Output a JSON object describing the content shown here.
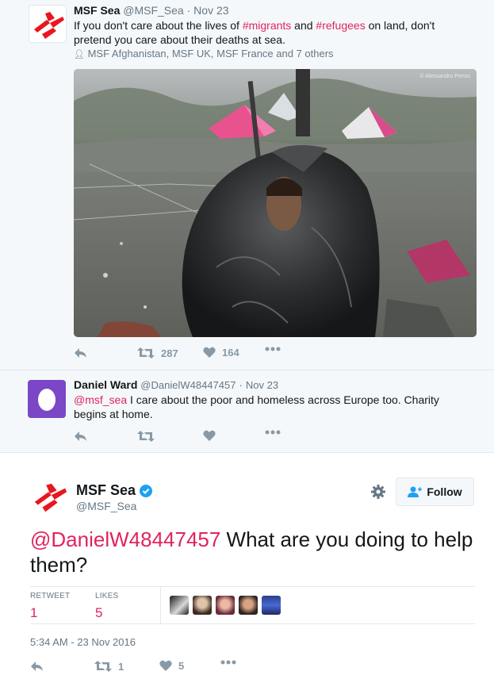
{
  "tweet1": {
    "name": "MSF Sea",
    "handle": "@MSF_Sea",
    "dot": "·",
    "date": "Nov 23",
    "text_before": "If you don't care about the lives of ",
    "hashtag1": "#migrants",
    "text_mid": " and ",
    "hashtag2": "#refugees",
    "text_after": " on land, don't pretend you care about their deaths at sea.",
    "context": "MSF Afghanistan, MSF UK, MSF France and 7 others",
    "photo_credit": "© Alessandro Penso",
    "retweets": "287",
    "likes": "164"
  },
  "tweet2": {
    "name": "Daniel Ward",
    "handle": "@DanielW48447457",
    "dot": "·",
    "date": "Nov 23",
    "mention": "@msf_sea",
    "text": " I care about the poor and homeless across Europe too. Charity begins at home."
  },
  "main": {
    "name": "MSF Sea",
    "handle": "@MSF_Sea",
    "follow_label": "Follow",
    "mention": "@DanielW48447457",
    "text": " What are you doing to help them?",
    "retweet_label": "RETWEET",
    "retweet_count": "1",
    "likes_label": "LIKES",
    "likes_count": "5",
    "timestamp": "5:34 AM - 23 Nov 2016",
    "action_retweets": "1",
    "action_likes": "5"
  },
  "icons": {
    "reply": "reply-icon",
    "retweet": "retweet-icon",
    "like": "heart-icon",
    "more": "more-icon",
    "verified": "verified-icon",
    "gear": "gear-icon",
    "follow": "add-user-icon"
  },
  "colors": {
    "link": "#e0245e",
    "msf_red": "#e8161f",
    "verified": "#1da1f2",
    "avatar_purple": "#7b47c7"
  }
}
